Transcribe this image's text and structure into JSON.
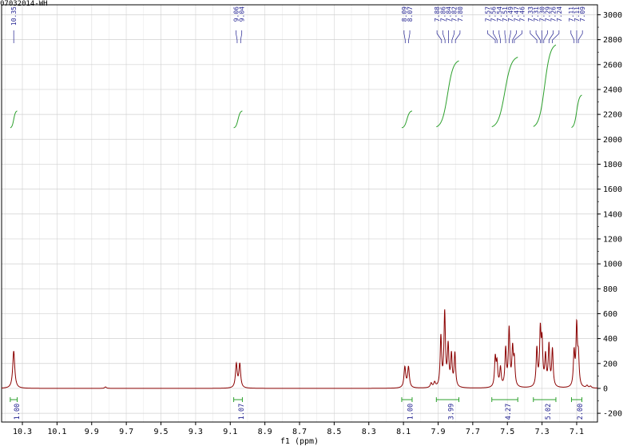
{
  "sample_label": "07032014-WH",
  "chart_data": {
    "type": "line",
    "title": "",
    "xlabel": "f1 (ppm)",
    "ylabel": "",
    "xlim": [
      10.42,
      6.98
    ],
    "ylim": [
      -270,
      3080
    ],
    "x_reversed": true,
    "grid": true,
    "x_ticks": [
      "10.3",
      "10.1",
      "9.9",
      "9.7",
      "9.5",
      "9.3",
      "9.1",
      "8.9",
      "8.7",
      "8.5",
      "8.3",
      "8.1",
      "7.9",
      "7.7",
      "7.5",
      "7.3",
      "7.1"
    ],
    "y_ticks": [
      "-200",
      "0",
      "200",
      "400",
      "600",
      "800",
      "1000",
      "1200",
      "1400",
      "1600",
      "1800",
      "2000",
      "2200",
      "2400",
      "2600",
      "2800",
      "3000"
    ],
    "colors": {
      "spectrum": "#8b0000",
      "integral": "#2ca02c",
      "label": "#1f1f8f",
      "grid": "#d0d0d0"
    },
    "peaks": [
      {
        "ppm": 10.35,
        "height": 300,
        "width": 0.007
      },
      {
        "ppm": 9.82,
        "height": 12,
        "width": 0.006
      },
      {
        "ppm": 9.065,
        "height": 190,
        "width": 0.006
      },
      {
        "ppm": 9.045,
        "height": 190,
        "width": 0.006
      },
      {
        "ppm": 8.092,
        "height": 165,
        "width": 0.006
      },
      {
        "ppm": 8.071,
        "height": 165,
        "width": 0.006
      },
      {
        "ppm": 7.94,
        "height": 35,
        "width": 0.006
      },
      {
        "ppm": 7.92,
        "height": 40,
        "width": 0.006
      },
      {
        "ppm": 7.884,
        "height": 400,
        "width": 0.005
      },
      {
        "ppm": 7.862,
        "height": 590,
        "width": 0.005
      },
      {
        "ppm": 7.842,
        "height": 320,
        "width": 0.005
      },
      {
        "ppm": 7.823,
        "height": 250,
        "width": 0.005
      },
      {
        "ppm": 7.803,
        "height": 270,
        "width": 0.005
      },
      {
        "ppm": 7.57,
        "height": 230,
        "width": 0.005
      },
      {
        "ppm": 7.56,
        "height": 180,
        "width": 0.005
      },
      {
        "ppm": 7.54,
        "height": 150,
        "width": 0.005
      },
      {
        "ppm": 7.51,
        "height": 300,
        "width": 0.005
      },
      {
        "ppm": 7.49,
        "height": 460,
        "width": 0.005
      },
      {
        "ppm": 7.47,
        "height": 290,
        "width": 0.005
      },
      {
        "ppm": 7.46,
        "height": 200,
        "width": 0.005
      },
      {
        "ppm": 7.33,
        "height": 300,
        "width": 0.005
      },
      {
        "ppm": 7.31,
        "height": 430,
        "width": 0.005
      },
      {
        "ppm": 7.3,
        "height": 330,
        "width": 0.005
      },
      {
        "ppm": 7.28,
        "height": 240,
        "width": 0.005
      },
      {
        "ppm": 7.26,
        "height": 330,
        "width": 0.005
      },
      {
        "ppm": 7.24,
        "height": 300,
        "width": 0.005
      },
      {
        "ppm": 7.115,
        "height": 270,
        "width": 0.005
      },
      {
        "ppm": 7.1,
        "height": 480,
        "width": 0.005
      },
      {
        "ppm": 7.09,
        "height": 220,
        "width": 0.005
      },
      {
        "ppm": 7.04,
        "height": 18,
        "width": 0.006
      },
      {
        "ppm": 7.02,
        "height": 14,
        "width": 0.006
      }
    ],
    "peak_labels": [
      {
        "group": [
          10.35
        ],
        "labels": [
          "10.35"
        ],
        "ppms": [
          10.35
        ]
      },
      {
        "group": [
          9.06,
          9.04
        ],
        "labels": [
          "9.06",
          "9.04"
        ],
        "ppms": [
          9.06,
          9.04
        ]
      },
      {
        "group": [
          8.09,
          8.07
        ],
        "labels": [
          "8.09",
          "8.07"
        ],
        "ppms": [
          8.09,
          8.07
        ]
      },
      {
        "group": [
          7.88,
          7.8
        ],
        "labels": [
          "7.88",
          "7.86",
          "7.84",
          "7.82",
          "7.80"
        ],
        "ppms": [
          7.88,
          7.86,
          7.84,
          7.82,
          7.8
        ]
      },
      {
        "group": [
          7.57,
          7.46
        ],
        "labels": [
          "7.57",
          "7.56",
          "7.54",
          "7.51",
          "7.49",
          "7.47",
          "7.46"
        ],
        "ppms": [
          7.57,
          7.56,
          7.54,
          7.51,
          7.49,
          7.47,
          7.46
        ]
      },
      {
        "group": [
          7.33,
          7.24
        ],
        "labels": [
          "7.33",
          "7.31",
          "7.30",
          "7.29",
          "7.26",
          "7.24"
        ],
        "ppms": [
          7.33,
          7.31,
          7.3,
          7.29,
          7.26,
          7.24
        ]
      },
      {
        "group": [
          7.11,
          7.09
        ],
        "labels": [
          "7.11",
          "7.11",
          "7.09"
        ],
        "ppms": [
          7.115,
          7.1,
          7.09
        ]
      }
    ],
    "integrals": [
      {
        "from": 10.37,
        "to": 10.33,
        "value": "1.00",
        "y_start": 2090,
        "y_end": 2230
      },
      {
        "from": 9.08,
        "to": 9.03,
        "value": "1.07",
        "y_start": 2090,
        "y_end": 2230
      },
      {
        "from": 8.11,
        "to": 8.05,
        "value": "1.00",
        "y_start": 2090,
        "y_end": 2230
      },
      {
        "from": 7.91,
        "to": 7.78,
        "value": "3.99",
        "y_start": 2090,
        "y_end": 2640
      },
      {
        "from": 7.59,
        "to": 7.44,
        "value": "4.27",
        "y_start": 2090,
        "y_end": 2670
      },
      {
        "from": 7.35,
        "to": 7.22,
        "value": "5.02",
        "y_start": 2090,
        "y_end": 2770
      },
      {
        "from": 7.13,
        "to": 7.07,
        "value": "2.00",
        "y_start": 2090,
        "y_end": 2360
      }
    ]
  }
}
